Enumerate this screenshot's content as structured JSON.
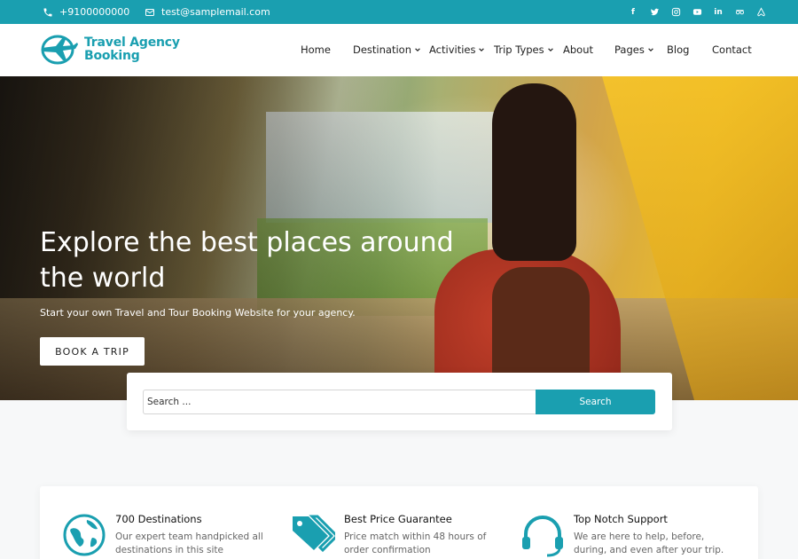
{
  "topbar": {
    "phone": "+9100000000",
    "email": "test@samplemail.com",
    "socials": [
      "facebook-icon",
      "twitter-icon",
      "instagram-icon",
      "youtube-icon",
      "linkedin-icon",
      "tripadvisor-icon",
      "airbnb-icon"
    ]
  },
  "logo": {
    "line1": "Travel Agency",
    "line2": "Booking"
  },
  "nav": {
    "items": [
      {
        "label": "Home",
        "dropdown": false
      },
      {
        "label": "Destination",
        "dropdown": true
      },
      {
        "label": "Activities",
        "dropdown": true
      },
      {
        "label": "Trip Types",
        "dropdown": true
      },
      {
        "label": "About",
        "dropdown": false
      },
      {
        "label": "Pages",
        "dropdown": true
      },
      {
        "label": "Blog",
        "dropdown": false
      },
      {
        "label": "Contact",
        "dropdown": false
      }
    ]
  },
  "hero": {
    "title": "Explore the best places around the world",
    "subtitle": "Start your own Travel and Tour Booking Website for your agency.",
    "button": "BOOK A TRIP"
  },
  "search": {
    "placeholder": "Search ...",
    "button": "Search"
  },
  "features": [
    {
      "icon": "globe-icon",
      "title": "700 Destinations",
      "desc": "Our expert team handpicked all destinations in this site"
    },
    {
      "icon": "price-tag-icon",
      "title": "Best Price Guarantee",
      "desc": "Price match within 48 hours of order confirmation"
    },
    {
      "icon": "headset-icon",
      "title": "Top Notch Support",
      "desc": "We are here to help, before, during, and even after your trip."
    }
  ],
  "colors": {
    "accent": "#1a9fb0",
    "white": "#ffffff"
  }
}
